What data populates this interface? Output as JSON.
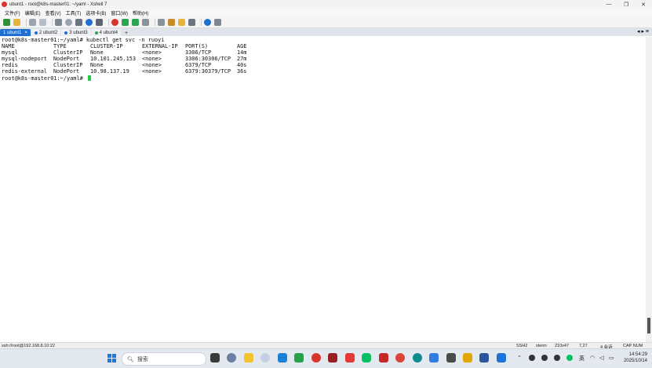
{
  "window": {
    "title": "ubunt1 - root@k8s-master01: ~/yaml - Xshell 7",
    "controls": [
      "—",
      "❐",
      "✕"
    ]
  },
  "menu": [
    "文件(F)",
    "编辑(E)",
    "查看(V)",
    "工具(T)",
    "选项卡(B)",
    "窗口(W)",
    "帮助(H)"
  ],
  "tabs": [
    {
      "label": "1 ubunt1",
      "close": "×",
      "dot": "#ffffff"
    },
    {
      "label": "2 ubunt2",
      "dot": "#1e6fd0"
    },
    {
      "label": "3 ubunt3",
      "dot": "#1e6fd0"
    },
    {
      "label": "4 ubunt4",
      "dot": "#2da44e"
    }
  ],
  "tab_add": "+",
  "tab_menu": "◂ ▸ ≡",
  "terminal": {
    "prompt": "root@k8s-master01:~/yaml# ",
    "command": "kubectl get svc -n ruoyi",
    "headers": [
      "NAME",
      "TYPE",
      "CLUSTER-IP",
      "EXTERNAL-IP",
      "PORT(S)",
      "AGE"
    ],
    "rows": [
      [
        "mysql",
        "ClusterIP",
        "None",
        "<none>",
        "3306/TCP",
        "14m"
      ],
      [
        "mysql-nodeport",
        "NodePort",
        "10.101.245.153",
        "<none>",
        "3306:30306/TCP",
        "27m"
      ],
      [
        "redis",
        "ClusterIP",
        "None",
        "<none>",
        "6379/TCP",
        "40s"
      ],
      [
        "redis-external",
        "NodePort",
        "10.98.137.19",
        "<none>",
        "6379:30379/TCP",
        "36s"
      ]
    ],
    "final_prompt": "root@k8s-master01:~/yaml# "
  },
  "status": {
    "connection": "ssh://root@192.168.8.10:22",
    "protocol": "SSH2",
    "term": "xterm",
    "size": "210x47",
    "cursor_pos": "7,27",
    "sessions": "4 会话",
    "caps": "CAP NUM"
  },
  "taskbar": {
    "search_placeholder": "搜索",
    "ime": "英",
    "time": "14:54:29",
    "date": "2025/10/14"
  }
}
